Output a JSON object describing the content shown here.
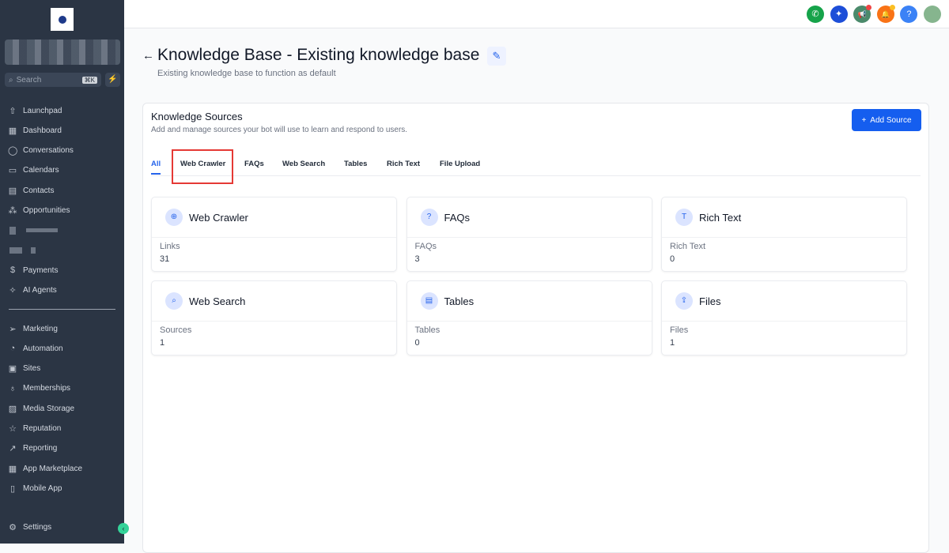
{
  "sidebar": {
    "search_placeholder": "Search",
    "search_shortcut": "⌘K",
    "items_top": [
      {
        "label": "Launchpad",
        "icon": "launchpad-icon",
        "glyph": "⇧"
      },
      {
        "label": "Dashboard",
        "icon": "dashboard-icon",
        "glyph": "▦"
      },
      {
        "label": "Conversations",
        "icon": "chat-icon",
        "glyph": "◯"
      },
      {
        "label": "Calendars",
        "icon": "calendar-icon",
        "glyph": "▭"
      },
      {
        "label": "Contacts",
        "icon": "contacts-icon",
        "glyph": "▤"
      },
      {
        "label": "Opportunities",
        "icon": "opportunities-icon",
        "glyph": "⁂"
      }
    ],
    "items_mid": [
      {
        "label": "Payments",
        "icon": "payments-icon",
        "glyph": "$"
      },
      {
        "label": "AI Agents",
        "icon": "sparkle-icon",
        "glyph": "✧"
      }
    ],
    "items_bottom": [
      {
        "label": "Marketing",
        "icon": "send-icon",
        "glyph": "➢"
      },
      {
        "label": "Automation",
        "icon": "automation-icon",
        "glyph": "◔"
      },
      {
        "label": "Sites",
        "icon": "sites-icon",
        "glyph": "▣"
      },
      {
        "label": "Memberships",
        "icon": "award-icon",
        "glyph": "♁"
      },
      {
        "label": "Media Storage",
        "icon": "image-icon",
        "glyph": "▨"
      },
      {
        "label": "Reputation",
        "icon": "star-icon",
        "glyph": "☆"
      },
      {
        "label": "Reporting",
        "icon": "trend-icon",
        "glyph": "↗"
      },
      {
        "label": "App Marketplace",
        "icon": "apps-icon",
        "glyph": "▦"
      },
      {
        "label": "Mobile App",
        "icon": "mobile-icon",
        "glyph": "▯"
      }
    ],
    "settings": "Settings"
  },
  "topbar": {
    "icons": [
      {
        "name": "phone-icon",
        "glyph": "✆",
        "color": "#16a34a"
      },
      {
        "name": "sparkles-icon",
        "glyph": "✦",
        "color": "#1d4ed8"
      },
      {
        "name": "megaphone-icon",
        "glyph": "📢",
        "color": "#4b8a6b"
      },
      {
        "name": "bell-icon",
        "glyph": "🔔",
        "color": "#f97316"
      },
      {
        "name": "help-icon",
        "glyph": "?",
        "color": "#3b82f6"
      }
    ]
  },
  "header": {
    "title": "Knowledge Base - Existing knowledge base",
    "subtitle": "Existing knowledge base to function as default"
  },
  "sources": {
    "title": "Knowledge Sources",
    "subtitle": "Add and manage sources your bot will use to learn and respond to users.",
    "add_label": "Add Source",
    "tabs": [
      "All",
      "Web Crawler",
      "FAQs",
      "Web Search",
      "Tables",
      "Rich Text",
      "File Upload"
    ],
    "active_tab": "All",
    "tiles": [
      {
        "name": "Web Crawler",
        "label": "Links",
        "value": "31",
        "icon": "globe-icon",
        "glyph": "⊕"
      },
      {
        "name": "FAQs",
        "label": "FAQs",
        "value": "3",
        "icon": "question-icon",
        "glyph": "?"
      },
      {
        "name": "Rich Text",
        "label": "Rich Text",
        "value": "0",
        "icon": "text-icon",
        "glyph": "T"
      },
      {
        "name": "Web Search",
        "label": "Sources",
        "value": "1",
        "icon": "search-icon",
        "glyph": "⌕"
      },
      {
        "name": "Tables",
        "label": "Tables",
        "value": "0",
        "icon": "table-icon",
        "glyph": "▤"
      },
      {
        "name": "Files",
        "label": "Files",
        "value": "1",
        "icon": "upload-icon",
        "glyph": "⇪"
      }
    ]
  },
  "colors": {
    "accent": "#155eef",
    "highlight": "#e53935",
    "sidebar": "#2b3544"
  }
}
